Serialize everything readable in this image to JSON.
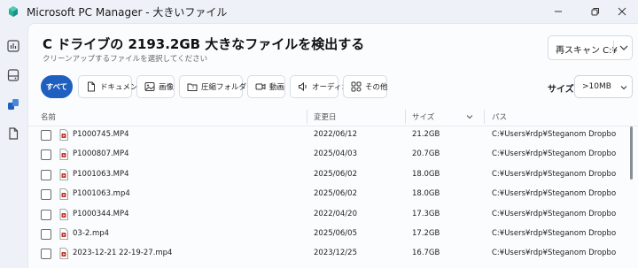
{
  "window": {
    "title": "Microsoft PC Manager - 大きいファイル",
    "minimize_icon": "minimize-icon",
    "maximize_icon": "restore-icon",
    "close_icon": "close-icon"
  },
  "nav": [
    {
      "name": "dashboard",
      "icon": "chart-icon"
    },
    {
      "name": "storage",
      "icon": "storage-icon"
    },
    {
      "name": "apps",
      "icon": "apps-icon"
    },
    {
      "name": "files",
      "icon": "file-icon"
    }
  ],
  "header": {
    "title": "C ドライブの 2193.2GB 大きなファイルを検出する",
    "subtitle": "クリーンアップするファイルを選択してください",
    "rescan_label": "再スキャン C:¥"
  },
  "filters": [
    {
      "label": "すべて",
      "icon": "",
      "active": true
    },
    {
      "label": "ドキュメント",
      "icon": "document-icon",
      "active": false
    },
    {
      "label": "画像",
      "icon": "image-icon",
      "active": false
    },
    {
      "label": "圧縮フォルダー",
      "icon": "zip-folder-icon",
      "active": false
    },
    {
      "label": "動画",
      "icon": "video-icon",
      "active": false
    },
    {
      "label": "オーディオ",
      "icon": "audio-icon",
      "active": false
    },
    {
      "label": "その他",
      "icon": "other-icon",
      "active": false
    }
  ],
  "size_filter": {
    "label": "サイズ",
    "value": ">10MB"
  },
  "table": {
    "columns": [
      "名前",
      "変更日",
      "サイズ",
      "パス"
    ],
    "rows": [
      {
        "name": "P1000745.MP4",
        "date": "2022/06/12",
        "size": "21.2GB",
        "path": "C:¥Users¥rdp¥Steganom Dropbox¥..."
      },
      {
        "name": "P1000807.MP4",
        "date": "2025/04/03",
        "size": "20.7GB",
        "path": "C:¥Users¥rdp¥Steganom Dropbox¥..."
      },
      {
        "name": "P1001063.MP4",
        "date": "2025/06/02",
        "size": "18.0GB",
        "path": "C:¥Users¥rdp¥Steganom Dropbox¥..."
      },
      {
        "name": "P1001063.mp4",
        "date": "2025/06/02",
        "size": "18.0GB",
        "path": "C:¥Users¥rdp¥Steganom Dropbox¥..."
      },
      {
        "name": "P1000344.MP4",
        "date": "2022/04/20",
        "size": "17.3GB",
        "path": "C:¥Users¥rdp¥Steganom Dropbox¥..."
      },
      {
        "name": "03-2.mp4",
        "date": "2025/06/05",
        "size": "17.2GB",
        "path": "C:¥Users¥rdp¥Steganom Dropbox¥..."
      },
      {
        "name": "2023-12-21 22-19-27.mp4",
        "date": "2023/12/25",
        "size": "16.7GB",
        "path": "C:¥Users¥rdp¥Steganom Dropbox¥..."
      }
    ]
  },
  "colors": {
    "accent": "#1f5fbf",
    "file_icon": "#c0392b"
  }
}
